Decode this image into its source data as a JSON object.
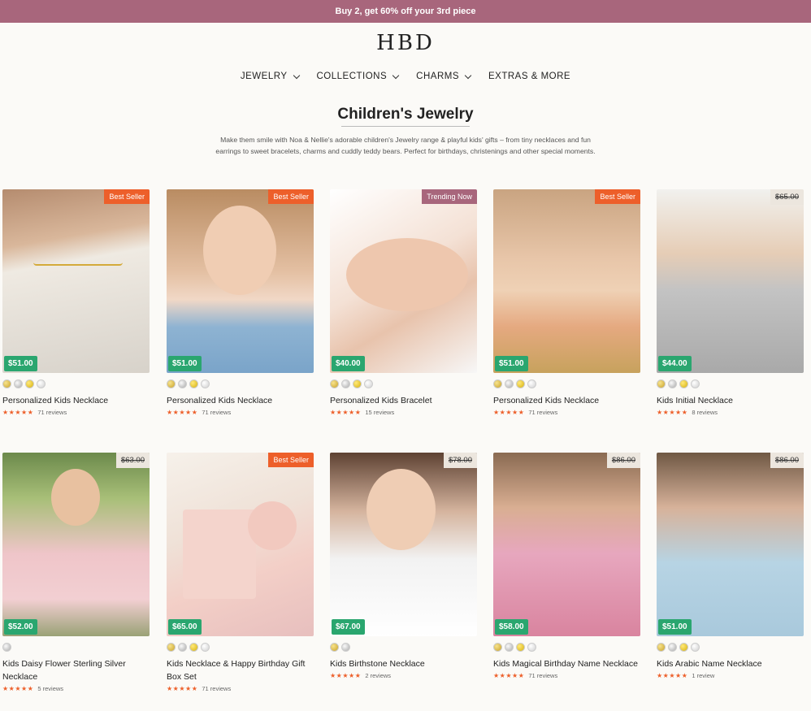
{
  "promo": "Buy 2, get 60% off your 3rd piece",
  "logo": "HBD",
  "nav": [
    "JEWELRY",
    "COLLECTIONS",
    "CHARMS",
    "EXTRAS & MORE"
  ],
  "title": "Children's Jewelry",
  "intro": "Make them smile with Noa & Nellie's adorable children's Jewelry range & playful kids' gifts – from tiny necklaces and fun earrings to sweet bracelets, charms and cuddly teddy bears. Perfect for birthdays, christenings and other special moments.",
  "colors": {
    "accent": "#a8667c",
    "badge_best": "#ed5f2a",
    "price_green": "#2aa66f",
    "star": "#ed5f2a"
  },
  "products": [
    {
      "name": "Personalized Kids Necklace",
      "price": "$51.00",
      "badge": "Best Seller",
      "badge_type": "best",
      "stars": "★★★★★",
      "reviews": "71 reviews",
      "swatches": [
        "gold",
        "silver",
        "yellow",
        "white"
      ]
    },
    {
      "name": "Personalized Kids Necklace",
      "price": "$51.00",
      "badge": "Best Seller",
      "badge_type": "best",
      "stars": "★★★★★",
      "reviews": "71 reviews",
      "swatches": [
        "gold",
        "silver",
        "yellow",
        "white"
      ]
    },
    {
      "name": "Personalized Kids Bracelet",
      "price": "$40.00",
      "badge": "Trending Now",
      "badge_type": "trend",
      "stars": "★★★★★",
      "reviews": "15 reviews",
      "swatches": [
        "gold",
        "silver",
        "yellow",
        "white"
      ]
    },
    {
      "name": "Personalized Kids Necklace",
      "price": "$51.00",
      "badge": "Best Seller",
      "badge_type": "best",
      "stars": "★★★★★",
      "reviews": "71 reviews",
      "swatches": [
        "gold",
        "silver",
        "yellow",
        "white"
      ]
    },
    {
      "name": "Kids Initial Necklace",
      "price": "$44.00",
      "badge": "$65.00",
      "badge_type": "old",
      "stars": "★★★★★",
      "reviews": "8 reviews",
      "swatches": [
        "gold",
        "silver",
        "yellow",
        "white"
      ]
    },
    {
      "name": "Kids Daisy Flower Sterling Silver Necklace",
      "price": "$52.00",
      "badge": "$63.00",
      "badge_type": "old",
      "stars": "★★★★★",
      "reviews": "5 reviews",
      "swatches": [
        "silver"
      ]
    },
    {
      "name": "Kids Necklace & Happy Birthday Gift Box Set",
      "price": "$65.00",
      "badge": "Best Seller",
      "badge_type": "best",
      "stars": "★★★★★",
      "reviews": "71 reviews",
      "swatches": [
        "gold",
        "silver",
        "yellow",
        "white"
      ]
    },
    {
      "name": "Kids Birthstone Necklace",
      "price": "$67.00",
      "badge": "$78.00",
      "badge_type": "old",
      "stars": "★★★★★",
      "reviews": "2 reviews",
      "swatches": [
        "gold",
        "silver"
      ]
    },
    {
      "name": "Kids Magical Birthday Name Necklace",
      "price": "$58.00",
      "badge": "$86.00",
      "badge_type": "old",
      "stars": "★★★★★",
      "reviews": "71 reviews",
      "swatches": [
        "gold",
        "silver",
        "yellow",
        "white"
      ]
    },
    {
      "name": "Kids Arabic Name Necklace",
      "price": "$51.00",
      "badge": "$86.00",
      "badge_type": "old",
      "stars": "★★★★★",
      "reviews": "1 review",
      "swatches": [
        "gold",
        "silver",
        "yellow",
        "white"
      ]
    }
  ]
}
